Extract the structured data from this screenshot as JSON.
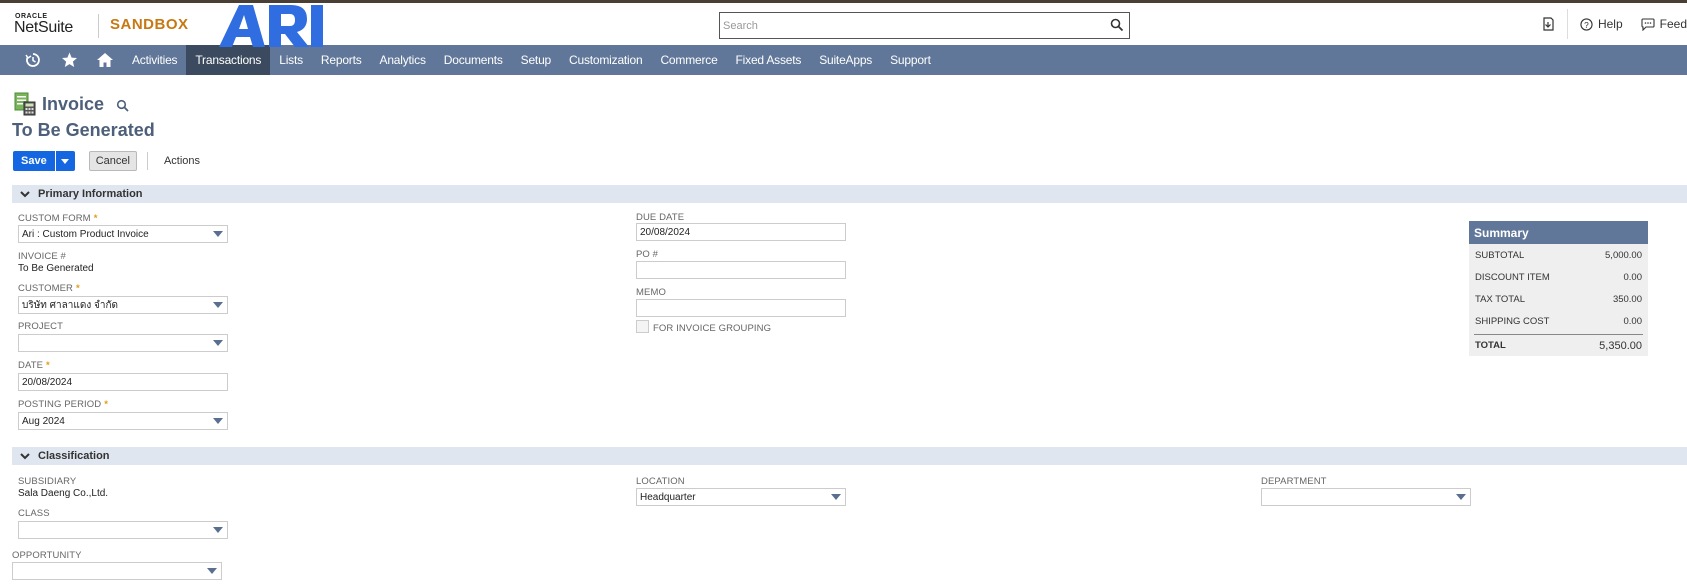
{
  "header": {
    "oracle_label": "ORACLE",
    "netsuite_label": "NetSuite",
    "environment_label": "SANDBOX",
    "search_placeholder": "Search",
    "help_label": "Help",
    "feedback_label": "Feed"
  },
  "nav": {
    "items": [
      "Activities",
      "Transactions",
      "Lists",
      "Reports",
      "Analytics",
      "Documents",
      "Setup",
      "Customization",
      "Commerce",
      "Fixed Assets",
      "SuiteApps",
      "Support"
    ],
    "active": "Transactions"
  },
  "page": {
    "title": "Invoice",
    "record_title": "To Be Generated"
  },
  "buttons": {
    "save": "Save",
    "cancel": "Cancel",
    "actions": "Actions"
  },
  "primary": {
    "section_title": "Primary Information",
    "custom_form_label": "CUSTOM FORM",
    "custom_form_value": "Ari : Custom Product Invoice",
    "invoice_no_label": "INVOICE #",
    "invoice_no_value": "To Be Generated",
    "customer_label": "CUSTOMER",
    "customer_value": "บริษัท ศาลาแดง จำกัด",
    "project_label": "PROJECT",
    "project_value": "",
    "date_label": "DATE",
    "date_value": "20/08/2024",
    "posting_period_label": "POSTING PERIOD",
    "posting_period_value": "Aug 2024",
    "due_date_label": "DUE DATE",
    "due_date_value": "20/08/2024",
    "po_label": "PO #",
    "po_value": "",
    "memo_label": "MEMO",
    "memo_value": "",
    "invoice_grouping_label": "FOR INVOICE GROUPING"
  },
  "summary": {
    "title": "Summary",
    "subtotal_label": "SUBTOTAL",
    "subtotal_value": "5,000.00",
    "discount_label": "DISCOUNT ITEM",
    "discount_value": "0.00",
    "tax_label": "TAX TOTAL",
    "tax_value": "350.00",
    "shipping_label": "SHIPPING COST",
    "shipping_value": "0.00",
    "total_label": "TOTAL",
    "total_value": "5,350.00"
  },
  "classification": {
    "section_title": "Classification",
    "subsidiary_label": "SUBSIDIARY",
    "subsidiary_value": "Sala Daeng Co.,Ltd.",
    "class_label": "CLASS",
    "class_value": "",
    "opportunity_label": "OPPORTUNITY",
    "opportunity_value": "",
    "location_label": "LOCATION",
    "location_value": "Headquarter",
    "department_label": "DEPARTMENT",
    "department_value": ""
  },
  "colors": {
    "nav_bg": "#607799",
    "nav_active": "#3b4a5e",
    "primary_button": "#1467e1",
    "sandbox": "#c77812",
    "required": "#e39a15"
  }
}
